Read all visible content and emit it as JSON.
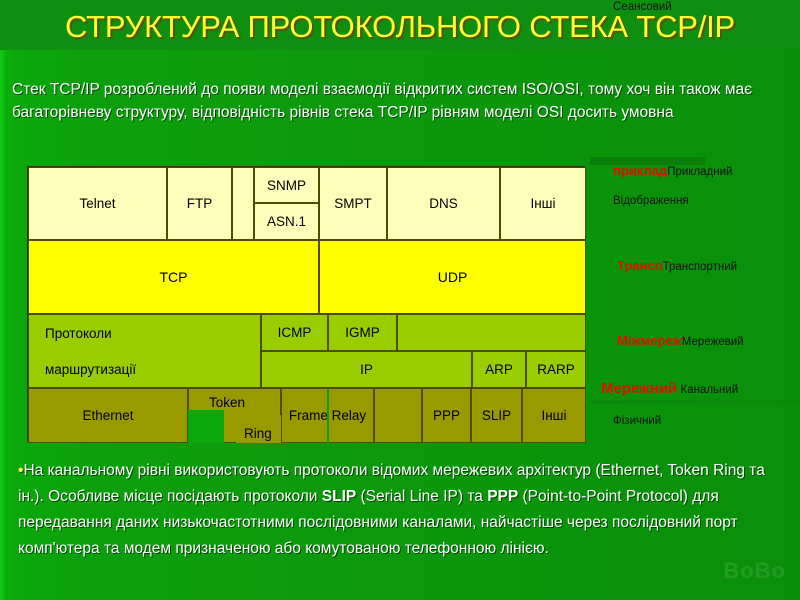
{
  "slide": {
    "title": "СТРУКТУРА ПРОТОКОЛЬНОГО СТЕКА TCP/IP",
    "intro": "Стек TCP/IP розроблений до появи моделі взаємодії відкритих систем ISO/OSI, тому хоч він також має багаторівневу структуру, відповідність рівнів стека TCP/IP рівням моделі OSI досить умовна",
    "watermark": "BoBo",
    "colors": {
      "background_green": "#0c9f0c",
      "title_yellow": "#ffff33",
      "application_row": "#ffffbb",
      "transport_row": "#ffff00",
      "internet_row": "#9acd00",
      "network_access_row": "#999900",
      "highlight_red": "#dd1100"
    }
  },
  "diagram": {
    "application_layer": {
      "cells": [
        "Telnet",
        "FTP",
        "SNMP",
        "SMPT",
        "DNS",
        "Інші"
      ],
      "sub_cell": "ASN.1"
    },
    "transport_layer": {
      "cells": [
        "TCP",
        "UDP"
      ]
    },
    "internet_layer": {
      "routing_line1": "Протоколи",
      "routing_line2": "маршрутизації",
      "cells_upper": [
        "ICMP",
        "IGMP"
      ],
      "cells_lower": [
        "IP",
        "ARP",
        "RARP"
      ]
    },
    "network_access_layer": {
      "cells": [
        "Ethernet",
        "Token",
        "Ring",
        "Frame Relay",
        "PPP",
        "SLIP",
        "Інші"
      ]
    }
  },
  "osi_labels": [
    {
      "highlight": "приклад",
      "rest": "Прикладний"
    },
    {
      "highlight": "",
      "rest": "Відображення"
    },
    {
      "highlight": "",
      "rest": "Сеансовий"
    },
    {
      "highlight": "Трансп",
      "rest": "Транспортний"
    },
    {
      "highlight": "Міжмереж",
      "rest": "Мережевий"
    },
    {
      "highlight": "Мережний",
      "rest": " Канальний"
    },
    {
      "highlight": "",
      "rest": "Фізичний"
    }
  ],
  "bottom_text": {
    "bullet": "•",
    "p1": "На канальному рівні використовують протоколи відомих мережевих архітектур (Ethernet, Token Ring та ін.). Особливе місце посідають протоколи ",
    "b1": "SLIP",
    "p2": " (Serial Line IP) та ",
    "b2": "PPP",
    "p3": " (Point-to-Point Protocol) для передавання даних низькочастотними послідовними каналами, найчастіше через послідовний порт комп'ютера та модем призначеною або комутованою телефонною лінією."
  }
}
